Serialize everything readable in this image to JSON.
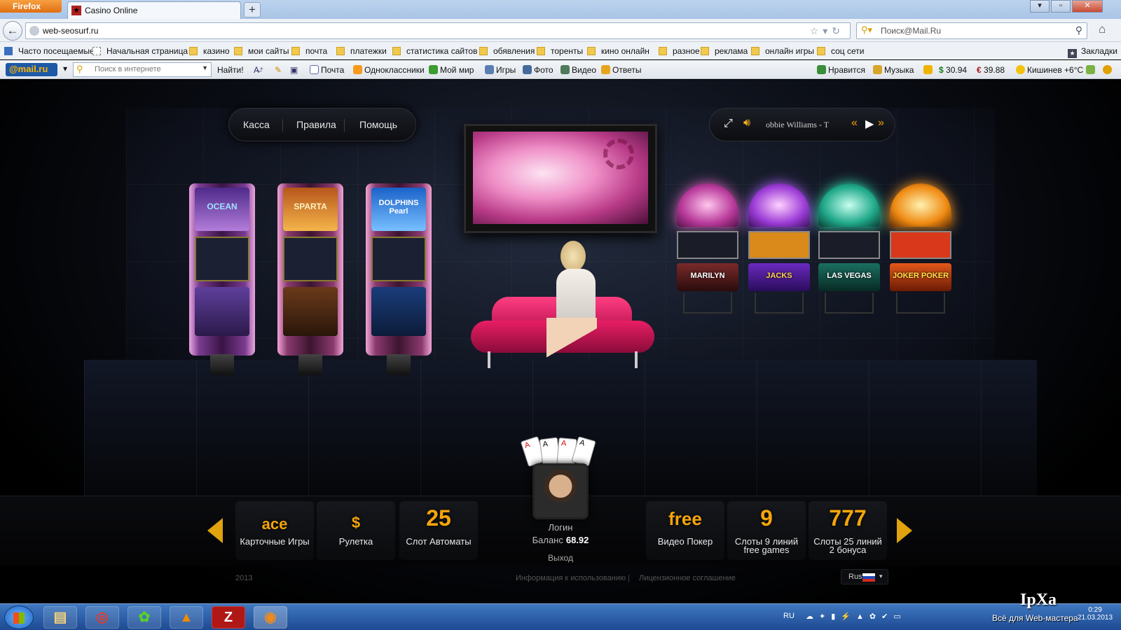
{
  "browser": {
    "app_button": "Firefox",
    "tab_title": "Casino Online",
    "url": "web-seosurf.ru",
    "search_placeholder": "Поиск@Mail.Ru"
  },
  "bookmarks": {
    "items": [
      "Часто посещаемые",
      "Начальная страница",
      "казино",
      "мои сайты",
      "почта",
      "платежки",
      "статистика сайтов",
      "обявления",
      "торенты",
      "кино онлайн",
      "разное",
      "реклама",
      "онлайн игры",
      "соц сети"
    ],
    "right": "Закладки"
  },
  "mailbar": {
    "logo": "@mail.ru",
    "search_placeholder": "Поиск в интернете",
    "find": "Найти!",
    "links": [
      "Почта",
      "Одноклассники",
      "Мой мир",
      "Игры",
      "Фото",
      "Видео",
      "Ответы"
    ],
    "likes": "Нравится",
    "music": "Музыка",
    "usd": "30.94",
    "eur": "39.88",
    "weather": "Кишинев +6°С"
  },
  "casino": {
    "menu": [
      "Касса",
      "Правила",
      "Помощь"
    ],
    "player_track": "obbie Williams - T",
    "slots_left": [
      "OCEAN",
      "SPARTA",
      "DOLPHINS Pearl"
    ],
    "slots_right": [
      "MARILYN",
      "JACKS",
      "LAS VEGAS",
      "JOKER POKER"
    ],
    "games": [
      {
        "icon": "ace",
        "label": "Карточные Игры",
        "label2": ""
      },
      {
        "icon": "$",
        "label": "Рулетка",
        "label2": ""
      },
      {
        "icon": "25",
        "label": "Слот Автоматы",
        "label2": ""
      },
      {
        "icon": "free",
        "label": "Видео Покер",
        "label2": ""
      },
      {
        "icon": "9",
        "label": "Слоты 9 линий",
        "label2": "free games"
      },
      {
        "icon": "777",
        "label": "Слоты 25 линий",
        "label2": "2 бонуса"
      }
    ],
    "profile": {
      "login": "Логин",
      "balance_label": "Баланс",
      "balance": "68.92",
      "logout": "Выход"
    },
    "footer": {
      "year": "2013",
      "terms": "Информация к использованию",
      "license": "Лицензионное соглашение",
      "lang": "Rus"
    }
  },
  "taskbar": {
    "lang": "RU",
    "watermark": "IpXa",
    "watermark_sub": "Всё для Web-мастера",
    "time": "0:29",
    "date": "21.03.2013"
  }
}
